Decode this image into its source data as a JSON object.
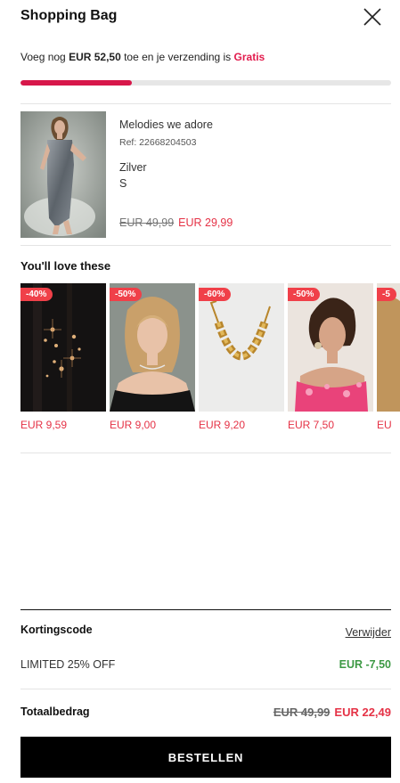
{
  "header": {
    "title": "Shopping Bag"
  },
  "shipping": {
    "prefix": "Voeg nog ",
    "amount": "EUR 52,50",
    "middle": " toe en je verzending is ",
    "free_label": "Gratis",
    "progress_fraction": 0.3
  },
  "cart_item": {
    "name": "Melodies we adore",
    "ref": "Ref: 22668204503",
    "color": "Zilver",
    "size": "S",
    "old_price": "EUR 49,99",
    "sale_price": "EUR 29,99"
  },
  "recommendations": {
    "title": "You'll love these",
    "items": [
      {
        "badge": "-40%",
        "price": "EUR 9,59"
      },
      {
        "badge": "-50%",
        "price": "EUR 9,00"
      },
      {
        "badge": "-60%",
        "price": "EUR 9,20"
      },
      {
        "badge": "-50%",
        "price": "EUR 7,50"
      },
      {
        "badge": "-5",
        "price": "EU"
      }
    ]
  },
  "summary": {
    "discount_label": "Kortingscode",
    "remove_label": "Verwijder",
    "code_name": "LIMITED 25% OFF",
    "code_value": "EUR -7,50",
    "total_label": "Totaalbedrag",
    "total_old": "EUR 49,99",
    "total_new": "EUR 22,49"
  },
  "checkout": {
    "button_label": "BESTELLEN"
  },
  "colors": {
    "accent": "#e21b4d",
    "sale": "#e53246",
    "discount": "#3d9944",
    "badge": "#f04049"
  }
}
